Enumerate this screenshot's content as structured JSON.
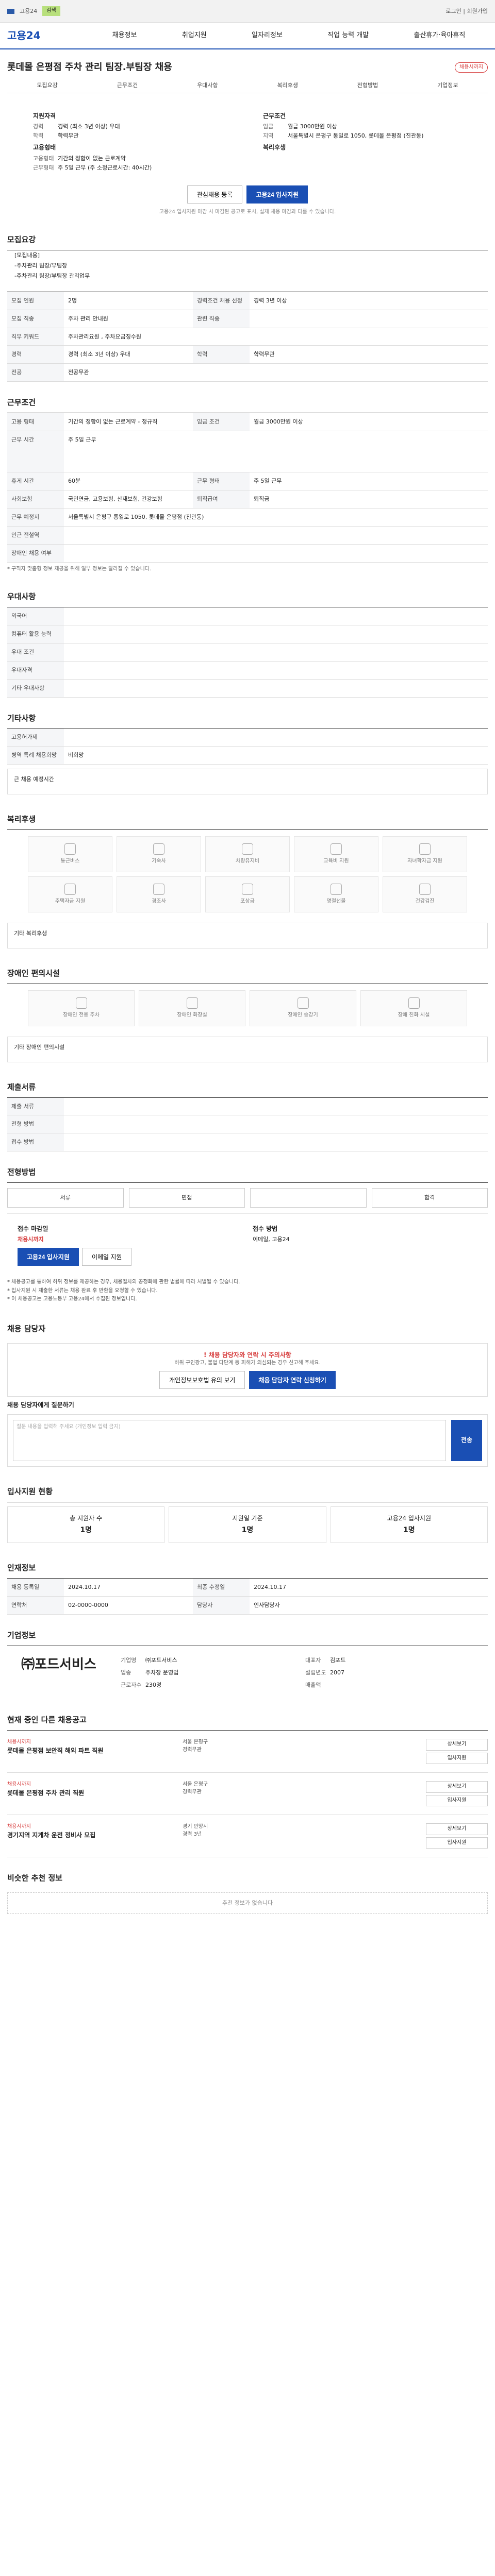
{
  "topbar": {
    "search_label": "검색",
    "site": "고용24",
    "right": "로그인 | 회원가입"
  },
  "gnb": {
    "logo": "고용24",
    "menu": [
      "채용정보",
      "취업지원",
      "일자리정보",
      "직업 능력 개발",
      "출산휴가·육아휴직"
    ]
  },
  "job": {
    "title": "롯데몰 은평점 주차 관리 팀장.부팀장 채용",
    "badge": "채용시까지",
    "subtabs": [
      "모집요강",
      "근무조건",
      "우대사항",
      "복리후생",
      "전형방법",
      "기업정보"
    ],
    "sum_left_h": "지원자격",
    "sum_left": [
      [
        "경력",
        "경력 (최소 3년 이상) 우대"
      ],
      [
        "학력",
        "학력무관"
      ]
    ],
    "sum_left_h2": "고용형태",
    "sum_left2": [
      [
        "고용형태",
        "기간의 정함이 없는 근로계약"
      ],
      [
        "근무형태",
        "주 5일 근무 (주 소정근로시간: 40시간)"
      ]
    ],
    "sum_right_h": "근무조건",
    "sum_right": [
      [
        "임금",
        "월급 3000만원 이상"
      ],
      [
        "지역",
        "서울특별시 은평구 통일로 1050, 롯데몰 은평점 (진관동)"
      ]
    ],
    "sum_right_h2": "복리후생",
    "btn_interest": "관심채용 등록",
    "btn_apply": "고용24 입사지원",
    "sum_note": "고용24 입사지원 마감 시 마감된 공고로 표시, 실제 채용 마감과 다를 수 있습니다."
  },
  "recruit": {
    "title": "모집요강",
    "lines": [
      "[모집내용]",
      "-주차관리 팀장/부팀장",
      "-주차관리 팀장/부팀장 관리업무"
    ],
    "rows": [
      [
        "모집 인원",
        "2명",
        "경력조건 채용 선정",
        "경력 3년 이상"
      ],
      [
        "모집 직종",
        "주차 관리 안내원",
        "관련 직종",
        ""
      ],
      [
        "직무 키워드",
        "주차관리요원 , 주차요금징수원",
        "",
        ""
      ],
      [
        "경력",
        "경력 (최소 3년 이상) 우대",
        "학력",
        "학력무관"
      ],
      [
        "전공",
        "전공무관",
        "",
        ""
      ]
    ]
  },
  "cond": {
    "title": "근무조건",
    "rows": [
      [
        "고용 형태",
        "기간의 정함이 없는 근로계약 - 정규직",
        "임금 조건",
        "월급 3000만원 이상"
      ],
      [
        "근무 시간",
        "주 5일 근무",
        "",
        ""
      ],
      [
        "휴게 시간",
        "60분",
        "근무 형태",
        "주 5일 근무"
      ],
      [
        "사회보험",
        "국민연금, 고용보험, 산재보험, 건강보험",
        "퇴직급여",
        "퇴직금"
      ],
      [
        "근무 예정지",
        "서울특별시 은평구 통일로 1050, 롯데몰 은평점 (진관동)",
        "",
        ""
      ],
      [
        "인근 전철역",
        "",
        "",
        ""
      ],
      [
        "장애인 채용 여부",
        "",
        "",
        ""
      ]
    ],
    "note": "* 구직자 맞춤형 정보 제공을 위해 일부 정보는 달라질 수 있습니다."
  },
  "pref": {
    "title": "우대사항",
    "rows": [
      [
        "외국어",
        ""
      ],
      [
        "컴퓨터 활용 능력",
        ""
      ],
      [
        "우대 조건",
        ""
      ],
      [
        "우대자격",
        ""
      ],
      [
        "기타 우대사항",
        ""
      ]
    ]
  },
  "etc": {
    "title": "기타사항",
    "rows": [
      [
        "고용허가제",
        ""
      ],
      [
        "병역 특례 채용희망",
        "비희망"
      ]
    ],
    "note": "근 채용 예정시간"
  },
  "welfare": {
    "title": "복리후생",
    "items": [
      "통근버스",
      "기숙사",
      "차량유지비",
      "교육비 지원",
      "자녀학자금 지원",
      "주택자금 지원",
      "경조사",
      "포상금",
      "명절선물",
      "건강검진"
    ],
    "textarea": "기타 복리후생"
  },
  "disab": {
    "title": "장애인 편의시설",
    "items": [
      "장애인 전용 주차",
      "장애인 화장실",
      "장애인 승강기",
      "장애 친화 시설"
    ],
    "textarea": "기타 장애인 편의시설"
  },
  "docs": {
    "title": "제출서류",
    "rows": [
      [
        "제출 서류",
        "",
        "",
        ""
      ],
      [
        "전형 방법",
        "",
        "",
        ""
      ],
      [
        "접수 방법",
        "",
        "",
        ""
      ]
    ]
  },
  "process": {
    "title": "전형방법",
    "tabs": [
      "서류",
      "면접",
      "",
      "합격"
    ],
    "apply_h": "접수 마감일",
    "apply_v": "채용시까지",
    "apply_btn": "고용24 입사지원",
    "email_btn": "이메일 지원",
    "contact_h": "접수 방법",
    "contact_v": "이메일, 고용24",
    "warn": [
      "* 채용공고를 통하여 허위 정보를 제공하는 경우, 채용절차의 공정화에 관한 법률에 따라 처벌될 수 있습니다.",
      "* 입사지원 시 제출한 서류는 채용 완료 후 반환을 요청할 수 있습니다.",
      "* 이 채용공고는 고용노동부 고용24에서 수집된 정보입니다."
    ]
  },
  "ask": {
    "title": "채용 담당자",
    "alert_t": "! 채용 담당자와 연락 시 주의사항",
    "alert_p": "허위 구인광고, 불법 다단계 등 피해가 의심되는 경우 신고해 주세요.",
    "btn1": "개인정보보호법 유의 보기",
    "btn2": "채용 담당자 연락 신청하기",
    "q_title": "채용 담당자에게 질문하기",
    "q_placeholder": "질문 내용을 입력해 주세요 (개인정보 입력 금지)",
    "q_send": "전송"
  },
  "stats": {
    "title": "입사지원 현황",
    "items": [
      [
        "총 지원자 수",
        "1명"
      ],
      [
        "지원일 기준",
        "1명"
      ],
      [
        "고용24 입사지원",
        "1명"
      ]
    ]
  },
  "contact": {
    "title": "인재정보",
    "rows": [
      [
        "채용 등록일",
        "2024.10.17",
        "최종 수정일",
        "2024.10.17"
      ],
      [
        "연락처",
        "02-0000-0000",
        "담당자",
        "인사담당자"
      ]
    ]
  },
  "company": {
    "title": "기업정보",
    "logo": "㈜포드서비스",
    "rows": [
      [
        "기업명",
        "㈜포드서비스"
      ],
      [
        "대표자",
        "김포드"
      ],
      [
        "업종",
        "주차장 운영업"
      ],
      [
        "설립년도",
        "2007"
      ],
      [
        "근로자수",
        "230명"
      ],
      [
        "매출액",
        ""
      ]
    ]
  },
  "others": {
    "title": "현재 중인 다른 채용공고",
    "list": [
      [
        "채용시까지",
        "롯데몰 은평점 보안직 해외 파트 직원",
        "서울 은평구",
        "경력무관"
      ],
      [
        "채용시까지",
        "롯데몰 은평점 주차 관리 직원",
        "서울 은평구",
        "경력무관"
      ],
      [
        "채용시까지",
        "경기지역 지게차 운전 정비사 모집",
        "경기 안양시",
        "경력 3년"
      ]
    ]
  },
  "similar": {
    "title": "비슷한 추천 정보",
    "empty": "추천 정보가 없습니다"
  }
}
